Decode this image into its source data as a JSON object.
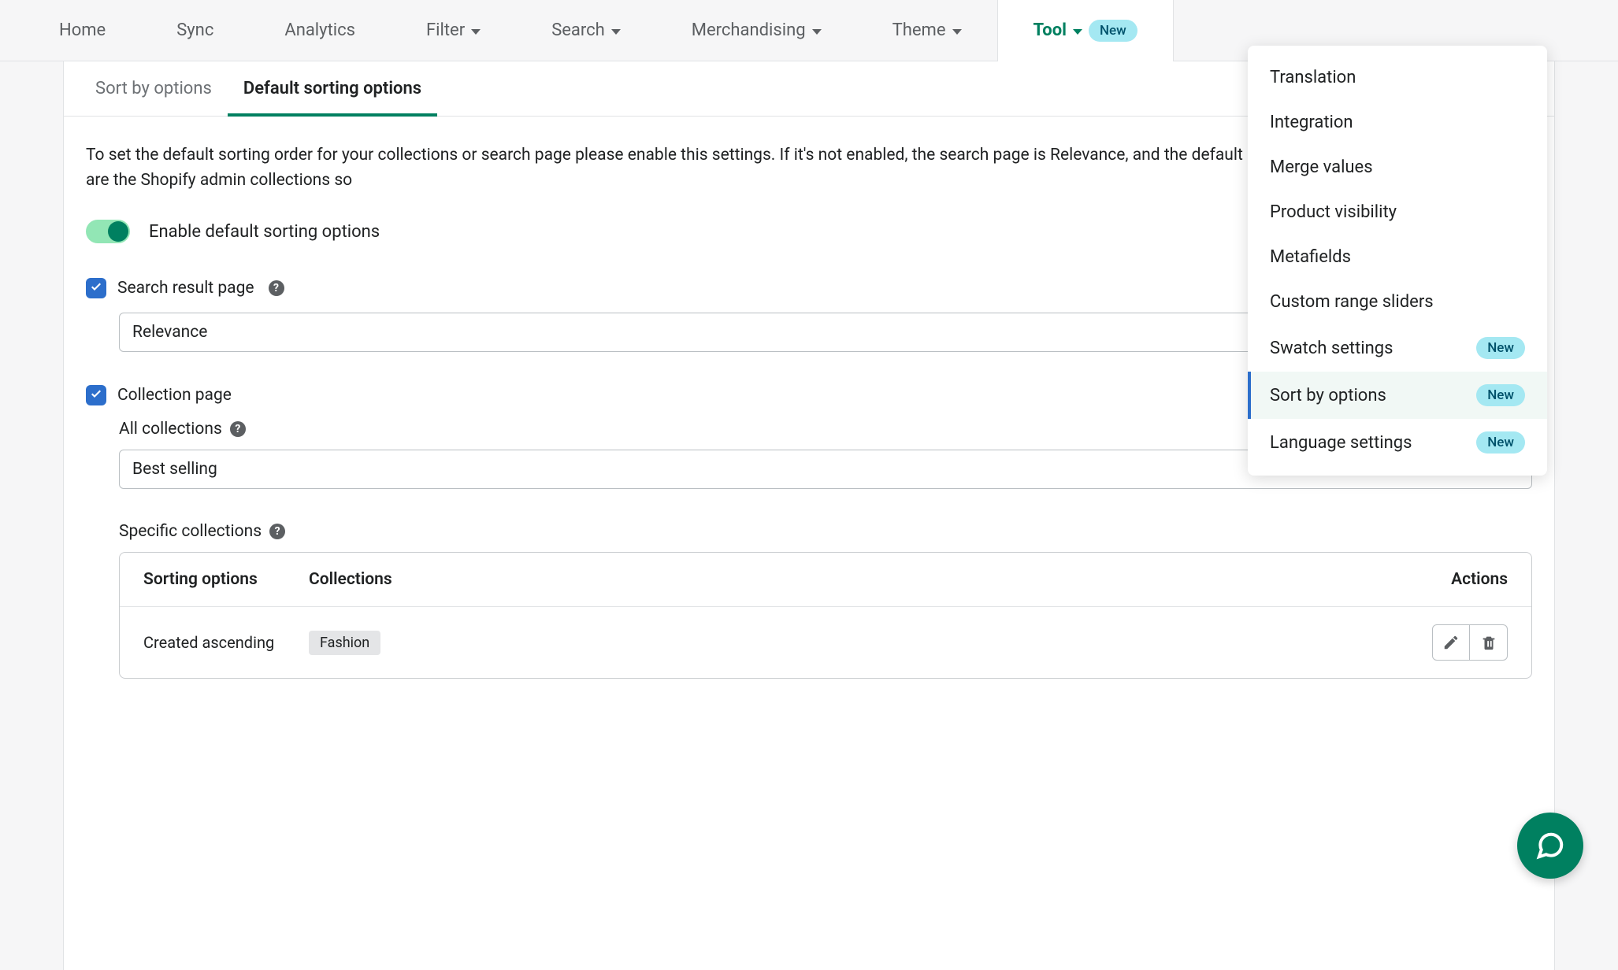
{
  "nav": {
    "home": "Home",
    "sync": "Sync",
    "analytics": "Analytics",
    "filter": "Filter",
    "search": "Search",
    "merchandising": "Merchandising",
    "theme": "Theme",
    "tool": "Tool",
    "new_badge": "New"
  },
  "dropdown": {
    "translation": "Translation",
    "integration": "Integration",
    "merge_values": "Merge values",
    "product_visibility": "Product visibility",
    "metafields": "Metafields",
    "custom_range_sliders": "Custom range sliders",
    "swatch_settings": "Swatch settings",
    "sort_by_options": "Sort by options",
    "language_settings": "Language settings"
  },
  "tabs": {
    "sort_by": "Sort by options",
    "default_sorting": "Default sorting options"
  },
  "content": {
    "description": "To set the default sorting order for your collections or search page please enable this settings. If it's not enabled, the search page is Relevance, and the default sorting order of the collections pages are the Shopify admin collections so",
    "enable_label": "Enable default sorting options",
    "search_page_label": "Search result page",
    "search_select_value": "Relevance",
    "collection_page_label": "Collection page",
    "all_collections_label": "All collections",
    "all_collections_value": "Best selling",
    "specific_collections_label": "Specific collections",
    "table": {
      "col_sorting": "Sorting options",
      "col_collections": "Collections",
      "col_actions": "Actions",
      "row1_sorting": "Created ascending",
      "row1_collection": "Fashion"
    }
  }
}
